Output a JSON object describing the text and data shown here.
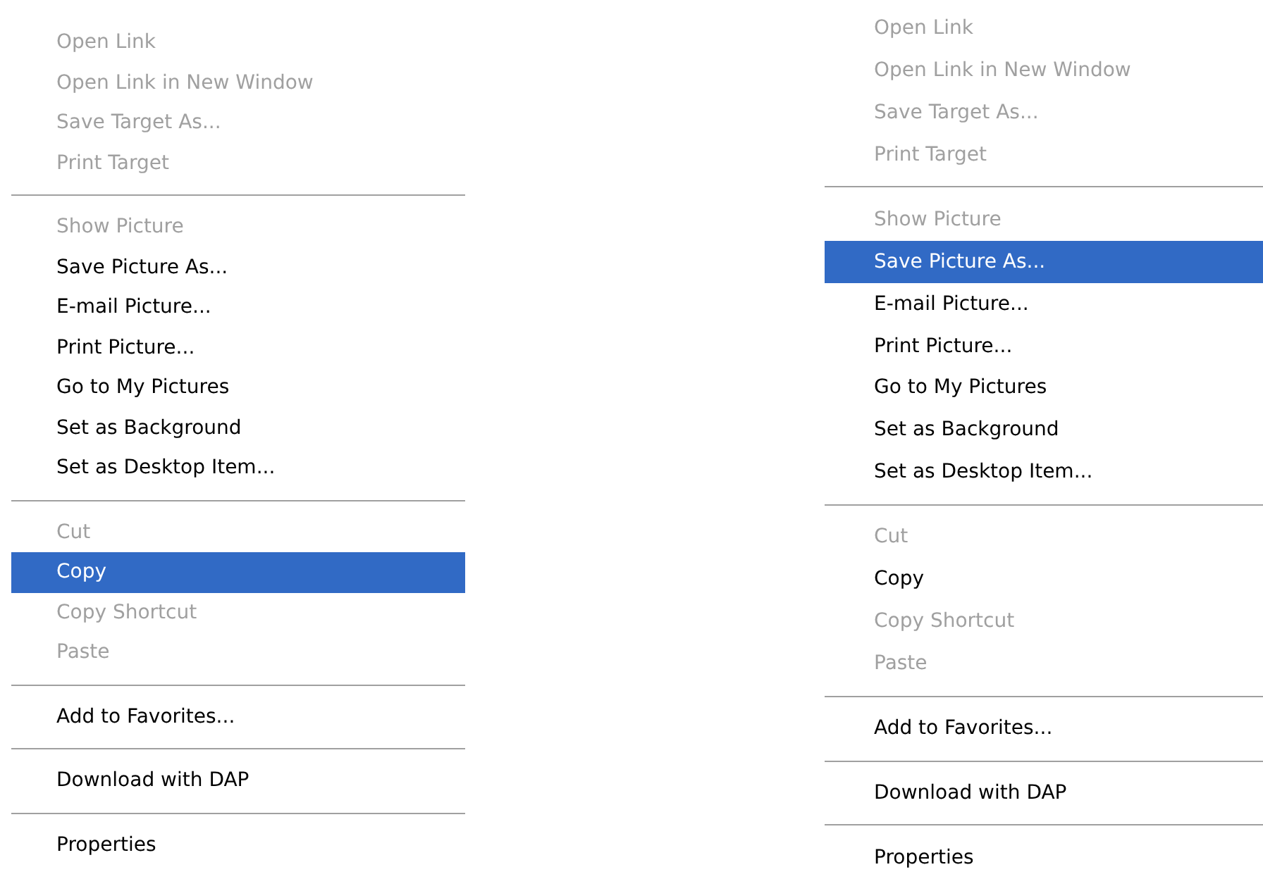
{
  "menus": [
    {
      "items": [
        {
          "kind": "item",
          "label": "Open Link",
          "disabled": true,
          "selected": false
        },
        {
          "kind": "item",
          "label": "Open Link in New Window",
          "disabled": true,
          "selected": false
        },
        {
          "kind": "item",
          "label": "Save Target As...",
          "disabled": true,
          "selected": false
        },
        {
          "kind": "item",
          "label": "Print Target",
          "disabled": true,
          "selected": false
        },
        {
          "kind": "separator"
        },
        {
          "kind": "item",
          "label": "Show Picture",
          "disabled": true,
          "selected": false
        },
        {
          "kind": "item",
          "label": "Save Picture As...",
          "disabled": false,
          "selected": false
        },
        {
          "kind": "item",
          "label": "E-mail Picture...",
          "disabled": false,
          "selected": false
        },
        {
          "kind": "item",
          "label": "Print Picture...",
          "disabled": false,
          "selected": false
        },
        {
          "kind": "item",
          "label": "Go to My Pictures",
          "disabled": false,
          "selected": false
        },
        {
          "kind": "item",
          "label": "Set as Background",
          "disabled": false,
          "selected": false
        },
        {
          "kind": "item",
          "label": "Set as Desktop Item...",
          "disabled": false,
          "selected": false
        },
        {
          "kind": "separator"
        },
        {
          "kind": "item",
          "label": "Cut",
          "disabled": true,
          "selected": false
        },
        {
          "kind": "item",
          "label": "Copy",
          "disabled": false,
          "selected": true
        },
        {
          "kind": "item",
          "label": "Copy Shortcut",
          "disabled": true,
          "selected": false
        },
        {
          "kind": "item",
          "label": "Paste",
          "disabled": true,
          "selected": false
        },
        {
          "kind": "separator"
        },
        {
          "kind": "item",
          "label": "Add to Favorites...",
          "disabled": false,
          "selected": false
        },
        {
          "kind": "separator"
        },
        {
          "kind": "item",
          "label": "Download with DAP",
          "disabled": false,
          "selected": false
        },
        {
          "kind": "separator"
        },
        {
          "kind": "item",
          "label": "Properties",
          "disabled": false,
          "selected": false
        }
      ]
    },
    {
      "items": [
        {
          "kind": "item",
          "label": "Open Link",
          "disabled": true,
          "selected": false
        },
        {
          "kind": "item",
          "label": "Open Link in New Window",
          "disabled": true,
          "selected": false
        },
        {
          "kind": "item",
          "label": "Save Target As...",
          "disabled": true,
          "selected": false
        },
        {
          "kind": "item",
          "label": "Print Target",
          "disabled": true,
          "selected": false
        },
        {
          "kind": "separator"
        },
        {
          "kind": "item",
          "label": "Show Picture",
          "disabled": true,
          "selected": false
        },
        {
          "kind": "item",
          "label": "Save Picture As...",
          "disabled": false,
          "selected": true
        },
        {
          "kind": "item",
          "label": "E-mail Picture...",
          "disabled": false,
          "selected": false
        },
        {
          "kind": "item",
          "label": "Print Picture...",
          "disabled": false,
          "selected": false
        },
        {
          "kind": "item",
          "label": "Go to My Pictures",
          "disabled": false,
          "selected": false
        },
        {
          "kind": "item",
          "label": "Set as Background",
          "disabled": false,
          "selected": false
        },
        {
          "kind": "item",
          "label": "Set as Desktop Item...",
          "disabled": false,
          "selected": false
        },
        {
          "kind": "separator"
        },
        {
          "kind": "item",
          "label": "Cut",
          "disabled": true,
          "selected": false
        },
        {
          "kind": "item",
          "label": "Copy",
          "disabled": false,
          "selected": false
        },
        {
          "kind": "item",
          "label": "Copy Shortcut",
          "disabled": true,
          "selected": false
        },
        {
          "kind": "item",
          "label": "Paste",
          "disabled": true,
          "selected": false
        },
        {
          "kind": "separator"
        },
        {
          "kind": "item",
          "label": "Add to Favorites...",
          "disabled": false,
          "selected": false
        },
        {
          "kind": "separator"
        },
        {
          "kind": "item",
          "label": "Download with DAP",
          "disabled": false,
          "selected": false
        },
        {
          "kind": "separator"
        },
        {
          "kind": "item",
          "label": "Properties",
          "disabled": false,
          "selected": false
        }
      ]
    }
  ]
}
